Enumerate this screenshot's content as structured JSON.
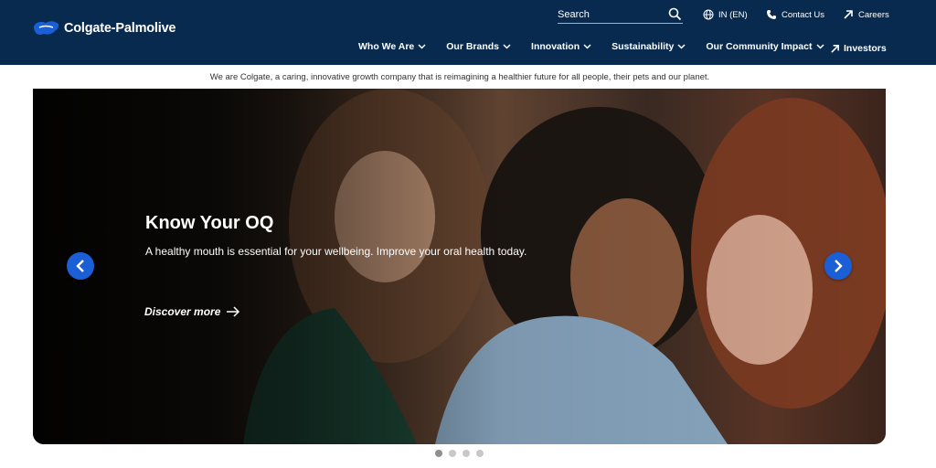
{
  "brand": {
    "name": "Colgate-Palmolive"
  },
  "search": {
    "placeholder": "Search"
  },
  "utility": {
    "language": "IN (EN)",
    "contact": "Contact Us",
    "careers": "Careers"
  },
  "nav": {
    "items": [
      {
        "label": "Who We Are"
      },
      {
        "label": "Our Brands"
      },
      {
        "label": "Innovation"
      },
      {
        "label": "Sustainability"
      },
      {
        "label": "Our Community Impact"
      }
    ],
    "investors": "Investors"
  },
  "tagline": "We are Colgate, a caring, innovative growth company that is reimagining a healthier future for all people, their pets and our planet.",
  "hero": {
    "title": "Know Your OQ",
    "description": "A healthy mouth is essential for your wellbeing. Improve your oral health today.",
    "cta": "Discover more"
  },
  "carousel": {
    "slide_count": 4,
    "active_index": 0
  },
  "colors": {
    "header_bg": "#092a4f",
    "accent_blue": "#1a5fd6",
    "white": "#ffffff"
  }
}
